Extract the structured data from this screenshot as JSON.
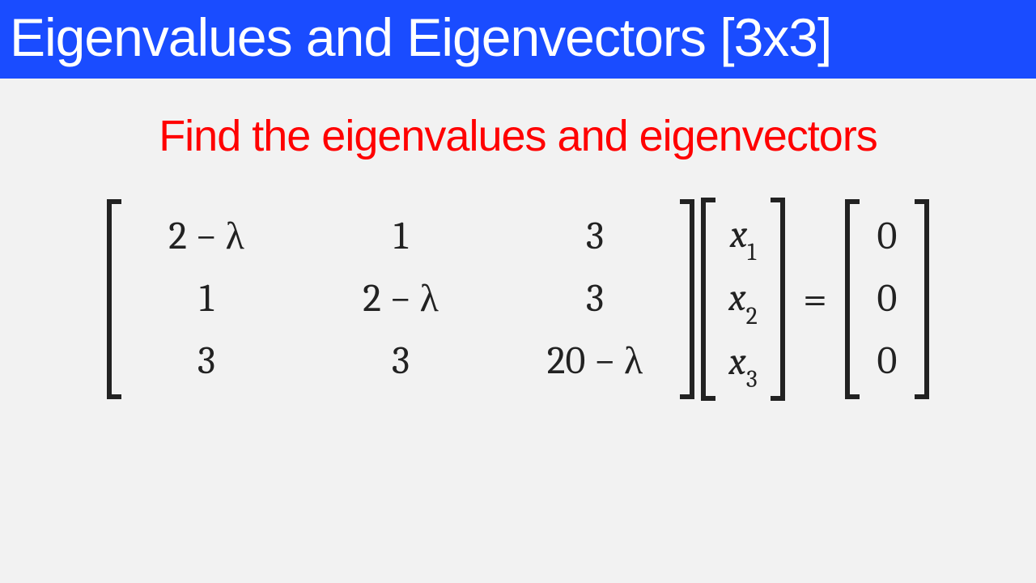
{
  "title": "Eigenvalues and Eigenvectors [3x3]",
  "subtitle": "Find the eigenvalues and eigenvectors",
  "lambda": "λ",
  "matrix_A": {
    "rows": [
      [
        "2 − λ",
        "1",
        "3"
      ],
      [
        "1",
        "2 − λ",
        "3"
      ],
      [
        "3",
        "3",
        "20 − λ"
      ]
    ]
  },
  "vector_x": {
    "entries": [
      {
        "var": "x",
        "sub": "1"
      },
      {
        "var": "x",
        "sub": "2"
      },
      {
        "var": "x",
        "sub": "3"
      }
    ]
  },
  "equals": "=",
  "vector_zero": {
    "entries": [
      "0",
      "0",
      "0"
    ]
  }
}
